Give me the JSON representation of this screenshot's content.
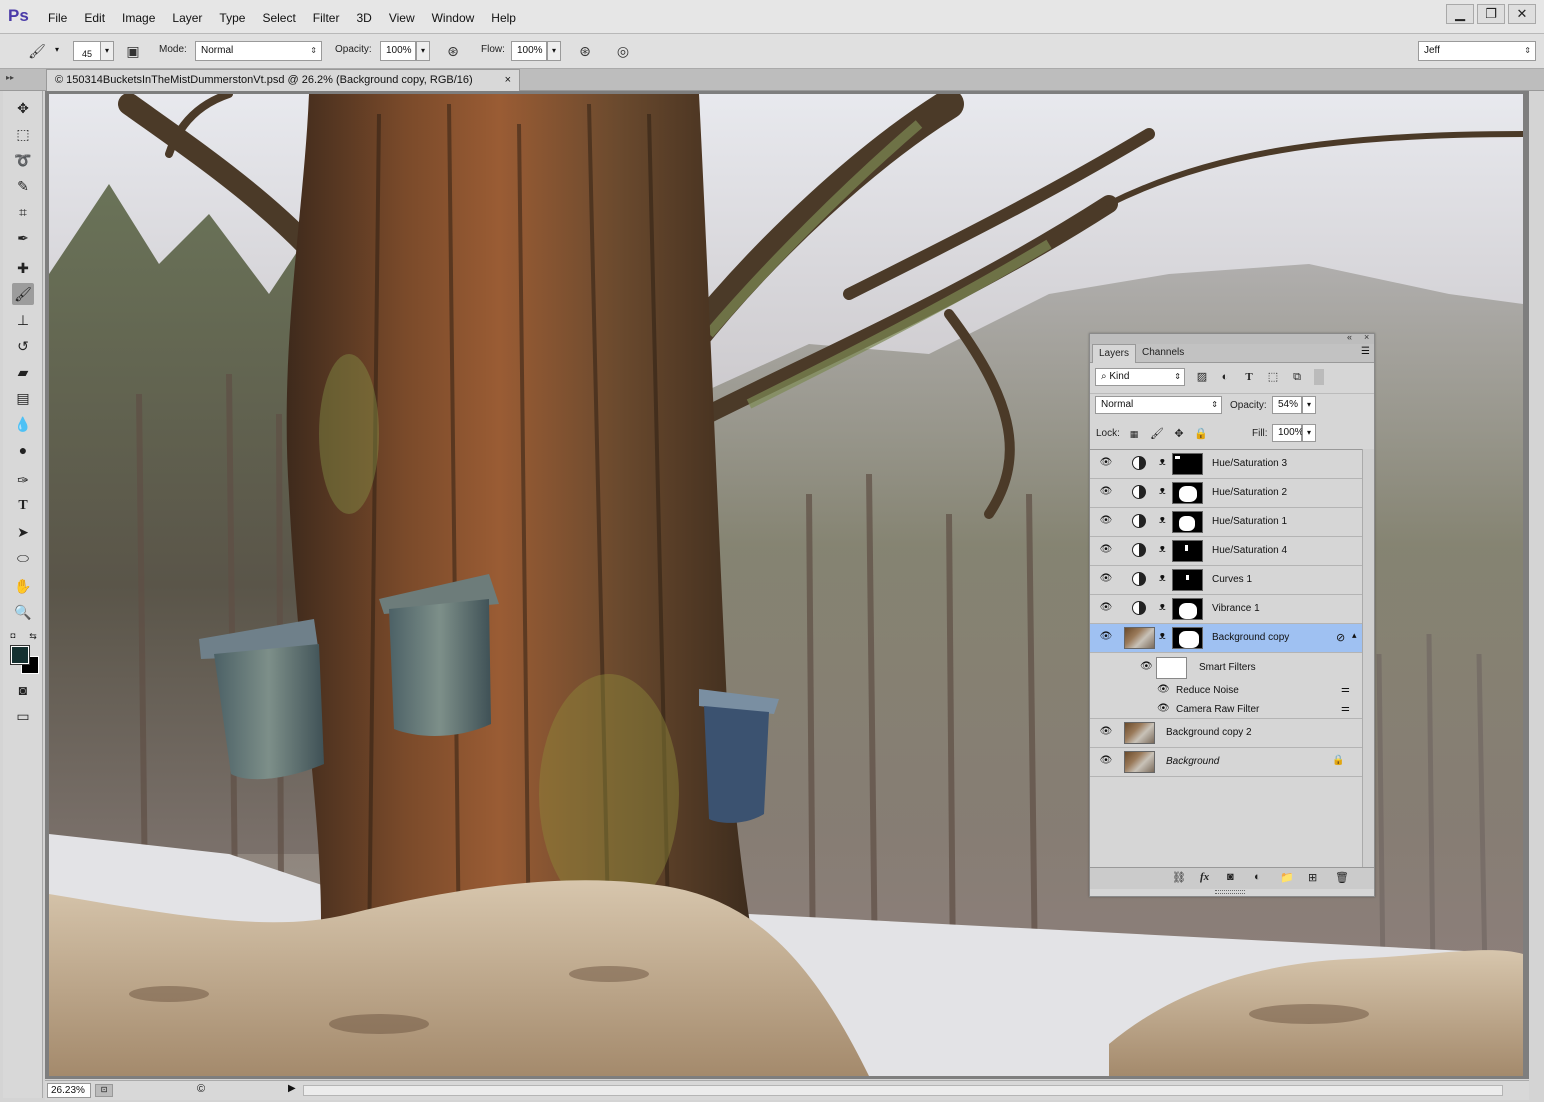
{
  "app": {
    "logo": "Ps"
  },
  "menu": [
    "File",
    "Edit",
    "Image",
    "Layer",
    "Type",
    "Select",
    "Filter",
    "3D",
    "View",
    "Window",
    "Help"
  ],
  "window_controls": {
    "minimize": "▁",
    "restore": "❐",
    "close": "✕"
  },
  "options": {
    "brush_size": "45",
    "mode_label": "Mode:",
    "mode_value": "Normal",
    "opacity_label": "Opacity:",
    "opacity_value": "100%",
    "flow_label": "Flow:",
    "flow_value": "100%",
    "workspace": "Jeff"
  },
  "document": {
    "tab_title": "© 150314BucketsInTheMistDummerstonVt.psd @ 26.2% (Background copy, RGB/16)",
    "close": "×"
  },
  "status": {
    "zoom": "26.23%",
    "copyright": "©",
    "arrow": "▶"
  },
  "layers_panel": {
    "tabs": [
      "Layers",
      "Channels"
    ],
    "filter_kind": "Kind",
    "blend_mode": "Normal",
    "opacity_label": "Opacity:",
    "opacity_value": "54%",
    "lock_label": "Lock:",
    "fill_label": "Fill:",
    "fill_value": "100%",
    "layers": [
      {
        "name": "Hue/Saturation 3"
      },
      {
        "name": "Hue/Saturation 2"
      },
      {
        "name": "Hue/Saturation 1"
      },
      {
        "name": "Hue/Saturation 4"
      },
      {
        "name": "Curves 1"
      },
      {
        "name": "Vibrance 1"
      },
      {
        "name": "Background copy"
      },
      {
        "name": "Smart Filters"
      },
      {
        "name": "Reduce Noise"
      },
      {
        "name": "Camera Raw Filter"
      },
      {
        "name": "Background copy 2"
      },
      {
        "name": "Background"
      }
    ]
  },
  "colors": {
    "accent_selection": "#9fc1f2",
    "foreground": "#153030",
    "background": "#000000"
  }
}
